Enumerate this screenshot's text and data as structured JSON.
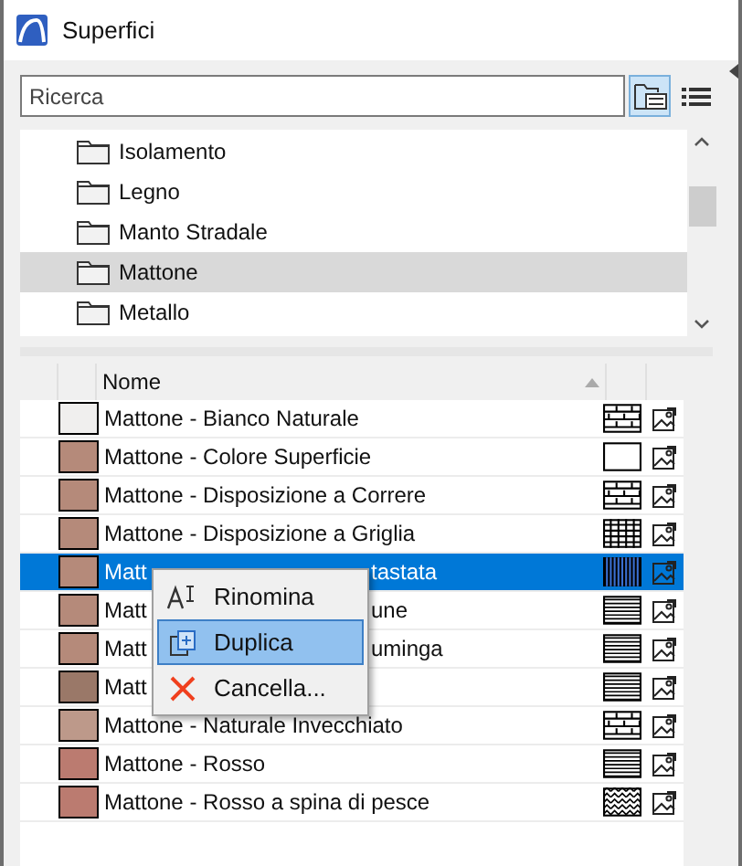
{
  "window": {
    "title": "Superfici"
  },
  "search": {
    "placeholder": "Ricerca"
  },
  "view_buttons": [
    {
      "kind": "folder-view",
      "selected": true
    },
    {
      "kind": "list-view",
      "selected": false
    }
  ],
  "folders": [
    {
      "name": "Isolamento",
      "selected": false
    },
    {
      "name": "Legno",
      "selected": false
    },
    {
      "name": "Manto Stradale",
      "selected": false
    },
    {
      "name": "Mattone",
      "selected": true
    },
    {
      "name": "Metallo",
      "selected": false
    }
  ],
  "table": {
    "columns": [
      "Nome"
    ],
    "rows": [
      {
        "name": "Mattone - Bianco Naturale",
        "color": "#f0efee",
        "kind": "brick",
        "selected": false
      },
      {
        "name": "Mattone - Colore Superficie",
        "color": "#b58a7a",
        "kind": "blank",
        "selected": false
      },
      {
        "name": "Mattone - Disposizione a Correre",
        "color": "#b58a7a",
        "kind": "brick",
        "selected": false
      },
      {
        "name": "Mattone - Disposizione a Griglia",
        "color": "#b58a7a",
        "kind": "grid",
        "selected": false
      },
      {
        "name": "Matt",
        "name_end": "tastata",
        "color": "#b58a7a",
        "kind": "vertical",
        "selected": true
      },
      {
        "name": "Matt",
        "name_end": "une",
        "color": "#b58a7a",
        "kind": "dense",
        "selected": false
      },
      {
        "name": "Matt",
        "name_end": "uminga",
        "color": "#b58a7a",
        "kind": "dense",
        "selected": false
      },
      {
        "name": "Matt",
        "color": "#9a7868",
        "kind": "dense",
        "selected": false
      },
      {
        "name": "Mattone - Naturale Invecchiato",
        "color": "#bd998a",
        "kind": "brick",
        "selected": false
      },
      {
        "name": "Mattone - Rosso",
        "color": "#bb7b70",
        "kind": "dense",
        "selected": false
      },
      {
        "name": "Mattone - Rosso a spina di pesce",
        "color": "#bb7b70",
        "kind": "herringbone",
        "selected": false
      }
    ]
  },
  "context_menu": [
    {
      "label": "Rinomina",
      "kind": "rename",
      "selected": false
    },
    {
      "label": "Duplica",
      "kind": "duplicate",
      "selected": true
    },
    {
      "label": "Cancella...",
      "kind": "delete",
      "selected": false
    }
  ]
}
